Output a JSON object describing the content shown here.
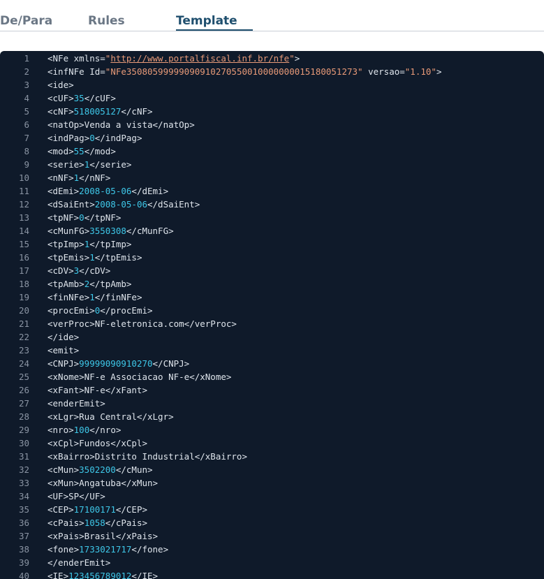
{
  "tabs": [
    {
      "label": "De/Para"
    },
    {
      "label": "Rules"
    },
    {
      "label": "Template",
      "active": true
    }
  ],
  "colors": {
    "editor_bg": "#0f1a2a",
    "tag_text": "#dfe5ec",
    "value_text": "#3ec7e8",
    "attr_string": "#e89a78",
    "line_number": "#8a94a3",
    "active_tab": "#1f4f6e",
    "inactive_tab": "#6b7785"
  },
  "editor": {
    "lines": [
      {
        "n": "1",
        "segments": [
          {
            "t": "<NFe xmlns="
          },
          {
            "t": "\"",
            "c": "s"
          },
          {
            "t": "http://www.portalfiscal.inf.br/nfe",
            "c": "s u"
          },
          {
            "t": "\"",
            "c": "s"
          },
          {
            "t": ">"
          }
        ]
      },
      {
        "n": "2",
        "segments": [
          {
            "t": "<infNFe Id="
          },
          {
            "t": "\"NFe35080599999090910270550010000000015180051273\"",
            "c": "s"
          },
          {
            "t": " versao="
          },
          {
            "t": "\"1.10\"",
            "c": "s"
          },
          {
            "t": ">"
          }
        ]
      },
      {
        "n": "3",
        "segments": [
          {
            "t": "<ide>"
          }
        ]
      },
      {
        "n": "4",
        "segments": [
          {
            "t": "<cUF>"
          },
          {
            "t": "35",
            "c": "v"
          },
          {
            "t": "</cUF>"
          }
        ]
      },
      {
        "n": "5",
        "segments": [
          {
            "t": "<cNF>"
          },
          {
            "t": "518005127",
            "c": "v"
          },
          {
            "t": "</cNF>"
          }
        ]
      },
      {
        "n": "6",
        "segments": [
          {
            "t": "<natOp>Venda a vista</natOp>"
          }
        ]
      },
      {
        "n": "7",
        "segments": [
          {
            "t": "<indPag>"
          },
          {
            "t": "0",
            "c": "v"
          },
          {
            "t": "</indPag>"
          }
        ]
      },
      {
        "n": "8",
        "segments": [
          {
            "t": "<mod>"
          },
          {
            "t": "55",
            "c": "v"
          },
          {
            "t": "</mod>"
          }
        ]
      },
      {
        "n": "9",
        "segments": [
          {
            "t": "<serie>"
          },
          {
            "t": "1",
            "c": "v"
          },
          {
            "t": "</serie>"
          }
        ]
      },
      {
        "n": "10",
        "segments": [
          {
            "t": "<nNF>"
          },
          {
            "t": "1",
            "c": "v"
          },
          {
            "t": "</nNF>"
          }
        ]
      },
      {
        "n": "11",
        "segments": [
          {
            "t": "<dEmi>"
          },
          {
            "t": "2008-05-06",
            "c": "v"
          },
          {
            "t": "</dEmi>"
          }
        ]
      },
      {
        "n": "12",
        "segments": [
          {
            "t": "<dSaiEnt>"
          },
          {
            "t": "2008-05-06",
            "c": "v"
          },
          {
            "t": "</dSaiEnt>"
          }
        ]
      },
      {
        "n": "13",
        "segments": [
          {
            "t": "<tpNF>"
          },
          {
            "t": "0",
            "c": "v"
          },
          {
            "t": "</tpNF>"
          }
        ]
      },
      {
        "n": "14",
        "segments": [
          {
            "t": "<cMunFG>"
          },
          {
            "t": "3550308",
            "c": "v"
          },
          {
            "t": "</cMunFG>"
          }
        ]
      },
      {
        "n": "15",
        "segments": [
          {
            "t": "<tpImp>"
          },
          {
            "t": "1",
            "c": "v"
          },
          {
            "t": "</tpImp>"
          }
        ]
      },
      {
        "n": "16",
        "segments": [
          {
            "t": "<tpEmis>"
          },
          {
            "t": "1",
            "c": "v"
          },
          {
            "t": "</tpEmis>"
          }
        ]
      },
      {
        "n": "17",
        "segments": [
          {
            "t": "<cDV>"
          },
          {
            "t": "3",
            "c": "v"
          },
          {
            "t": "</cDV>"
          }
        ]
      },
      {
        "n": "18",
        "segments": [
          {
            "t": "<tpAmb>"
          },
          {
            "t": "2",
            "c": "v"
          },
          {
            "t": "</tpAmb>"
          }
        ]
      },
      {
        "n": "19",
        "segments": [
          {
            "t": "<finNFe>"
          },
          {
            "t": "1",
            "c": "v"
          },
          {
            "t": "</finNFe>"
          }
        ]
      },
      {
        "n": "20",
        "segments": [
          {
            "t": "<procEmi>"
          },
          {
            "t": "0",
            "c": "v"
          },
          {
            "t": "</procEmi>"
          }
        ]
      },
      {
        "n": "21",
        "segments": [
          {
            "t": "<verProc>NF-eletronica.com</verProc>"
          }
        ]
      },
      {
        "n": "22",
        "segments": [
          {
            "t": "</ide>"
          }
        ]
      },
      {
        "n": "23",
        "segments": [
          {
            "t": "<emit>"
          }
        ]
      },
      {
        "n": "24",
        "segments": [
          {
            "t": "<CNPJ>"
          },
          {
            "t": "99999090910270",
            "c": "v"
          },
          {
            "t": "</CNPJ>"
          }
        ]
      },
      {
        "n": "25",
        "segments": [
          {
            "t": "<xNome>NF-e Associacao NF-e</xNome>"
          }
        ]
      },
      {
        "n": "26",
        "segments": [
          {
            "t": "<xFant>NF-e</xFant>"
          }
        ]
      },
      {
        "n": "27",
        "segments": [
          {
            "t": "<enderEmit>"
          }
        ]
      },
      {
        "n": "28",
        "segments": [
          {
            "t": "<xLgr>Rua Central</xLgr>"
          }
        ]
      },
      {
        "n": "29",
        "segments": [
          {
            "t": "<nro>"
          },
          {
            "t": "100",
            "c": "v"
          },
          {
            "t": "</nro>"
          }
        ]
      },
      {
        "n": "30",
        "segments": [
          {
            "t": "<xCpl>Fundos</xCpl>"
          }
        ]
      },
      {
        "n": "31",
        "segments": [
          {
            "t": "<xBairro>Distrito Industrial</xBairro>"
          }
        ]
      },
      {
        "n": "32",
        "segments": [
          {
            "t": "<cMun>"
          },
          {
            "t": "3502200",
            "c": "v"
          },
          {
            "t": "</cMun>"
          }
        ]
      },
      {
        "n": "33",
        "segments": [
          {
            "t": "<xMun>Angatuba</xMun>"
          }
        ]
      },
      {
        "n": "34",
        "segments": [
          {
            "t": "<UF>SP</UF>"
          }
        ]
      },
      {
        "n": "35",
        "segments": [
          {
            "t": "<CEP>"
          },
          {
            "t": "17100171",
            "c": "v"
          },
          {
            "t": "</CEP>"
          }
        ]
      },
      {
        "n": "36",
        "segments": [
          {
            "t": "<cPais>"
          },
          {
            "t": "1058",
            "c": "v"
          },
          {
            "t": "</cPais>"
          }
        ]
      },
      {
        "n": "37",
        "segments": [
          {
            "t": "<xPais>Brasil</xPais>"
          }
        ]
      },
      {
        "n": "38",
        "segments": [
          {
            "t": "<fone>"
          },
          {
            "t": "1733021717",
            "c": "v"
          },
          {
            "t": "</fone>"
          }
        ]
      },
      {
        "n": "39",
        "segments": [
          {
            "t": "</enderEmit>"
          }
        ]
      },
      {
        "n": "40",
        "segments": [
          {
            "t": "<IE>"
          },
          {
            "t": "123456789012",
            "c": "v"
          },
          {
            "t": "</IE>"
          }
        ]
      }
    ]
  }
}
